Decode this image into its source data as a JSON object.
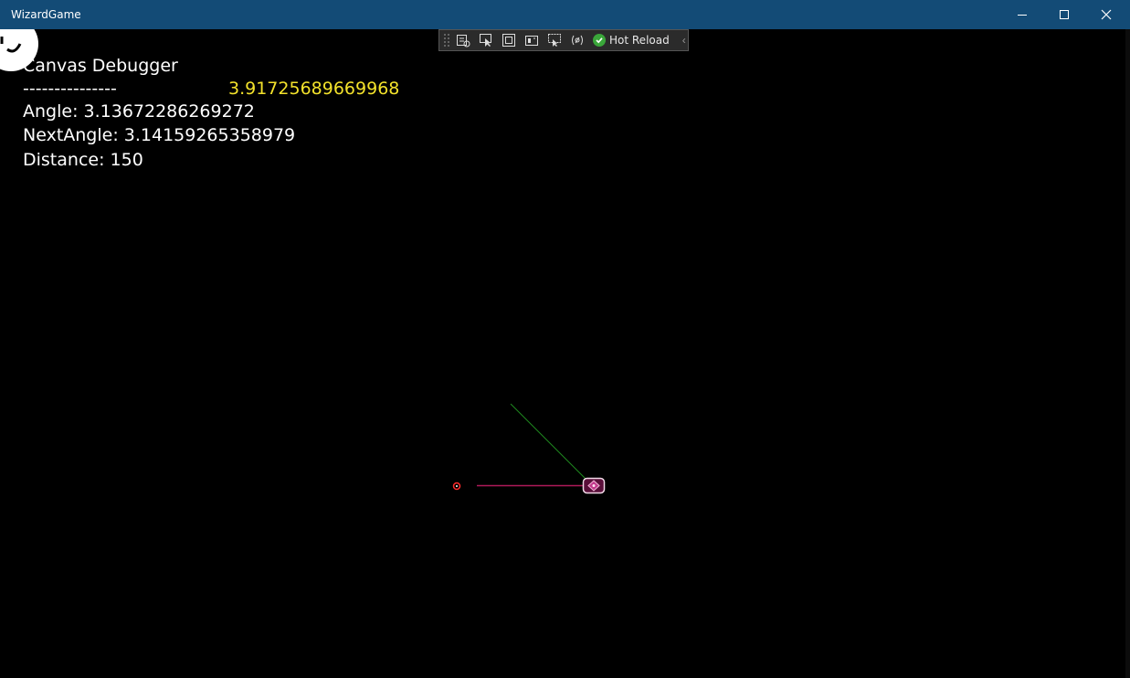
{
  "window": {
    "title": "WizardGame"
  },
  "toolbar": {
    "icons": [
      "live-visual-tree-icon",
      "select-element-icon",
      "layout-adorners-icon",
      "track-focus-icon",
      "display-layout-icon",
      "binding-failures-icon"
    ],
    "hot_reload_label": "Hot Reload"
  },
  "debugger": {
    "title": "Canvas Debugger",
    "separator": "---------------",
    "value_yellow": "3.91725689669968",
    "angle": "Angle: 3.13672286269272",
    "next_angle": "NextAngle: 3.14159265358979",
    "distance": "Distance: 150"
  },
  "colors": {
    "titlebar": "#134b76",
    "debug_text": "#ffffff",
    "debug_yellow": "#f3e22b",
    "magenta_line": "#b0195a",
    "green_line": "#1f8a1f"
  }
}
